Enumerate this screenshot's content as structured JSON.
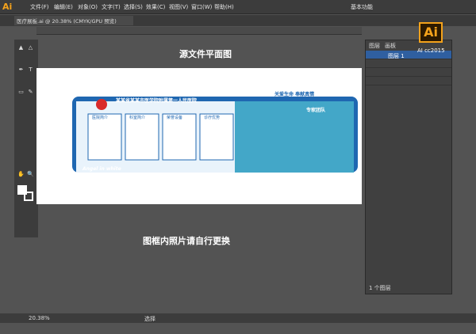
{
  "app": {
    "logo": "Ai",
    "version": "AI cc2015",
    "workspace": "基本功能"
  },
  "menu": [
    "文件(F)",
    "编辑(E)",
    "对象(O)",
    "文字(T)",
    "选择(S)",
    "效果(C)",
    "视图(V)",
    "窗口(W)",
    "帮助(H)"
  ],
  "doc_tab": "医疗展板.ai @ 20.38% (CMYK/GPU 预览)",
  "canvas": {
    "title": "源文件平面图",
    "note": "图框内照片请自行更换"
  },
  "design": {
    "hospital": "某某省某某市医学院附属第一人民医院",
    "slogan": "关爱生命 奉献真情",
    "panels": [
      "医院简介",
      "科室简介",
      "荣誉设备",
      "诊疗优势"
    ],
    "team": "专家团队",
    "en": "Angel in white"
  },
  "layers": {
    "tab1": "图层",
    "tab2": "画板",
    "count": "1 个图层",
    "top": "图层 1"
  },
  "status": {
    "zoom": "20.38%",
    "tool": "选择"
  }
}
